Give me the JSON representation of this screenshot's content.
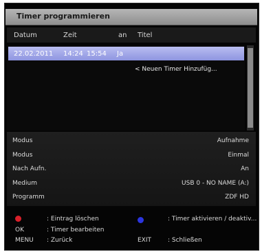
{
  "window": {
    "title": "Timer programmieren"
  },
  "columns": {
    "datum": "Datum",
    "zeit": "Zeit",
    "an": "an",
    "titel": "Titel"
  },
  "timer_row": {
    "date": "22.02.2011",
    "start": "14:24",
    "end": "15:54",
    "an": "Ja"
  },
  "add_timer_label": "< Neuen Timer Hinzufüg...",
  "details": [
    {
      "label": "Modus",
      "value": "Aufnahme"
    },
    {
      "label": "Modus",
      "value": "Einmal"
    },
    {
      "label": "Nach Aufn.",
      "value": "An"
    },
    {
      "label": "Medium",
      "value": "USB 0 - NO NAME (A:)"
    },
    {
      "label": "Programm",
      "value": "ZDF HD"
    }
  ],
  "footer": {
    "red_action": ": Eintrag löschen",
    "blue_action": ": Timer aktivieren / deaktiv...",
    "ok_key": "OK",
    "ok_action": ": Timer bearbeiten",
    "menu_key": "MENU",
    "menu_action": ": Zurück",
    "exit_key": "EXIT",
    "exit_action": ": Schließen"
  },
  "colors": {
    "red_button": "#d8202a",
    "blue_button": "#2b35e0",
    "selection": "#9aa0e6"
  },
  "icons": {
    "red": "red-button-icon",
    "blue": "blue-button-icon"
  }
}
